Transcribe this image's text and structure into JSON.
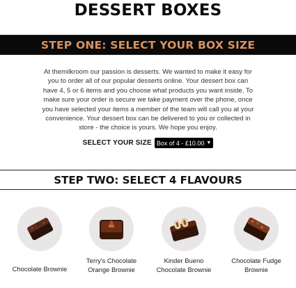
{
  "page": {
    "title": "DESSERT BOXES"
  },
  "step_one": {
    "heading": "STEP ONE: SELECT YOUR BOX SIZE",
    "intro": "At themilkroom our passion is desserts. We wanted to make it easy for you to order all of our popular desserts online. Your dessert box can have 4, 5 or 6 items and you choose what products you want inside. To make sure your order is secure we take payment over the phone, once you have selected your items a member of the team will call you at your convenience. Your dessert box can be delivered to you or collected in store - the choice is yours. We hope you enjoy.",
    "size_label": "SELECT YOUR SIZE",
    "size_selected": "Box of 4 - £10.00"
  },
  "step_two": {
    "heading": "STEP TWO: SELECT 4 FLAVOURS"
  },
  "products": [
    {
      "name": "Chocolate Brownie",
      "icon": "chocolate-brownie-icon"
    },
    {
      "name": "Terry's Chocolate Orange Brownie",
      "icon": "orange-brownie-icon"
    },
    {
      "name": "Kinder Bueno Chocolate Brownie",
      "icon": "bueno-brownie-icon"
    },
    {
      "name": "Chocolate Fudge Brownie",
      "icon": "fudge-brownie-icon"
    }
  ],
  "colors": {
    "bar_background": "#0a0a0a",
    "step_one_accent": "#d9925f",
    "circle_background": "#e8e6e6",
    "select_background": "#000000"
  }
}
